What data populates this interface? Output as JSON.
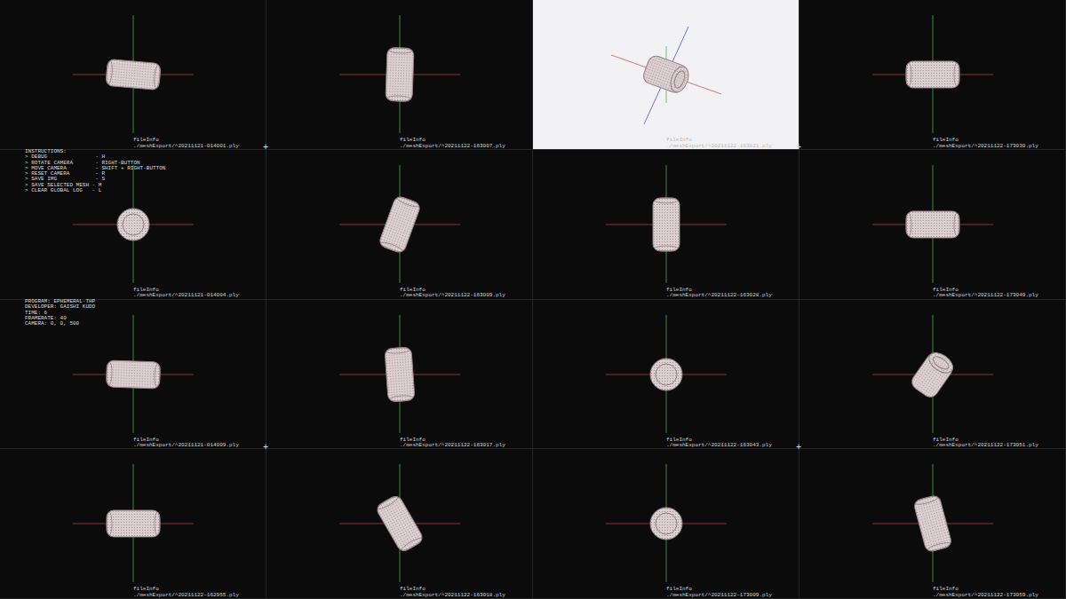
{
  "cells": [
    {
      "label": "fileInfo",
      "path": "./meshExport/^20211121-014001.ply",
      "selected": false,
      "mesh": {
        "view": "side",
        "rotation": 5
      }
    },
    {
      "label": "fileInfo",
      "path": "./meshExport/^20211122-163007.ply",
      "selected": false,
      "mesh": {
        "view": "side",
        "rotation": 92
      }
    },
    {
      "label": "fileInfo",
      "path": "./meshExport/^20211122-163021.ply",
      "selected": true,
      "mesh": {
        "view": "oblique",
        "rotation": 20
      }
    },
    {
      "label": "fileInfo",
      "path": "./meshExport/^20211122-173030.ply",
      "selected": false,
      "mesh": {
        "view": "side",
        "rotation": 0
      }
    },
    {
      "label": "fileInfo",
      "path": "./meshExport/^20211121-014004.ply",
      "selected": false,
      "mesh": {
        "view": "end",
        "rotation": 0
      }
    },
    {
      "label": "fileInfo",
      "path": "./meshExport/^20211122-163009.ply",
      "selected": false,
      "mesh": {
        "view": "side",
        "rotation": -70
      }
    },
    {
      "label": "fileInfo",
      "path": "./meshExport/^20211122-163028.ply",
      "selected": false,
      "mesh": {
        "view": "side",
        "rotation": 90
      }
    },
    {
      "label": "fileInfo",
      "path": "./meshExport/^20211122-173049.ply",
      "selected": false,
      "mesh": {
        "view": "side",
        "rotation": 0
      }
    },
    {
      "label": "fileInfo",
      "path": "./meshExport/^20211121-014009.ply",
      "selected": false,
      "mesh": {
        "view": "side",
        "rotation": 2
      }
    },
    {
      "label": "fileInfo",
      "path": "./meshExport/^20211122-163017.ply",
      "selected": false,
      "mesh": {
        "view": "side",
        "rotation": 86
      }
    },
    {
      "label": "fileInfo",
      "path": "./meshExport/^20211122-163043.ply",
      "selected": false,
      "mesh": {
        "view": "end",
        "rotation": 0
      }
    },
    {
      "label": "fileInfo",
      "path": "./meshExport/^20211122-173051.ply",
      "selected": false,
      "mesh": {
        "view": "oblique",
        "rotation": -55
      }
    },
    {
      "label": "fileInfo",
      "path": "./meshExport/^20211122-162955.ply",
      "selected": false,
      "mesh": {
        "view": "side",
        "rotation": 0
      }
    },
    {
      "label": "fileInfo",
      "path": "./meshExport/^20211122-163018.ply",
      "selected": false,
      "mesh": {
        "view": "side",
        "rotation": 60
      }
    },
    {
      "label": "fileInfo",
      "path": "./meshExport/^20211122-173009.ply",
      "selected": false,
      "mesh": {
        "view": "end",
        "rotation": 0
      }
    },
    {
      "label": "fileInfo",
      "path": "./meshExport/^20211122-173059.ply",
      "selected": false,
      "mesh": {
        "view": "side",
        "rotation": 75
      }
    }
  ],
  "instructions": [
    "INSTRUCTIONS:",
    "> DEBUG               - H",
    "> ROTATE CAMERA       - RIGHT-BUTTON",
    "> MOVE CAMERA         - SHIFT + RIGHT-BUTTON",
    "> RESET CAMERA        - R",
    "> SAVE IMG            - S",
    "> SAVE SELECTED MESH - M",
    "> CLEAR GLOBAL LOG   - L"
  ],
  "program_info": [
    "PROGRAM: EPHEMERAL-THP",
    "DEVELOPER: GAISHI KUDO",
    "TIME: 6",
    "FRAMERATE: 40",
    "CAMERA: 0, 0, 500"
  ],
  "crosshairs": [
    "+",
    "+",
    "+",
    "+"
  ]
}
